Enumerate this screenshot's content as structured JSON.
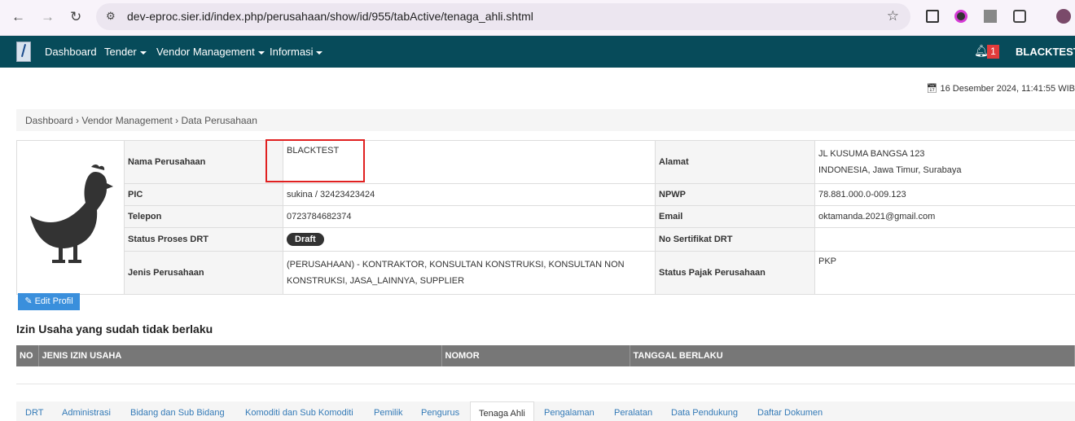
{
  "browser": {
    "url": "dev-eproc.sier.id/index.php/perusahaan/show/id/955/tabActive/tenaga_ahli.shtml"
  },
  "nav": {
    "items": [
      "Dashboard",
      "Tender",
      "Vendor Management",
      "Informasi"
    ],
    "notif_count": "1",
    "user": "BLACKTEST"
  },
  "date": "16 Desember 2024, 11:41:55 WIB",
  "breadcrumb": [
    "Dashboard",
    "Vendor Management",
    "Data Perusahaan"
  ],
  "company": {
    "nama_label": "Nama Perusahaan",
    "nama": "BLACKTEST",
    "alamat_label": "Alamat",
    "alamat_1": "JL KUSUMA BANGSA 123",
    "alamat_2": "INDONESIA, Jawa Timur, Surabaya",
    "pic_label": "PIC",
    "pic": "sukina / 32423423424",
    "npwp_label": "NPWP",
    "npwp": "78.881.000.0-009.123",
    "telepon_label": "Telepon",
    "telepon": "0723784682374",
    "email_label": "Email",
    "email": "oktamanda.2021@gmail.com",
    "status_label": "Status Proses DRT",
    "status": "Draft",
    "sertifikat_label": "No Sertifikat DRT",
    "sertifikat": "",
    "jenis_label": "Jenis Perusahaan",
    "jenis": "(PERUSAHAAN) - KONTRAKTOR, KONSULTAN KONSTRUKSI, KONSULTAN NON KONSTRUKSI, JASA_LAINNYA, SUPPLIER",
    "pajak_label": "Status Pajak Perusahaan",
    "pajak": "PKP"
  },
  "edit_button": "Edit Profil",
  "section_title": "Izin Usaha yang sudah tidak berlaku",
  "table_headers": [
    "NO",
    "JENIS IZIN USAHA",
    "NOMOR",
    "TANGGAL BERLAKU"
  ],
  "tabs": [
    "DRT",
    "Administrasi",
    "Bidang dan Sub Bidang",
    "Komoditi dan Sub Komoditi",
    "Pemilik",
    "Pengurus",
    "Tenaga Ahli",
    "Pengalaman",
    "Peralatan",
    "Data Pendukung",
    "Daftar Dokumen"
  ]
}
